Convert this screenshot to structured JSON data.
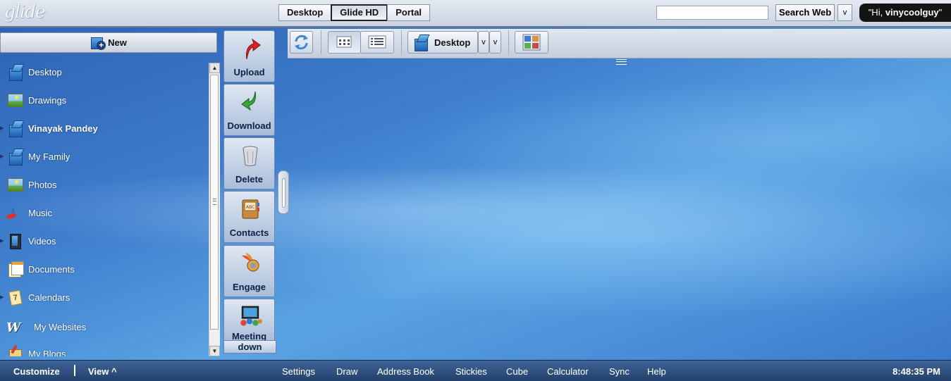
{
  "app": {
    "logo": "glide"
  },
  "top_tabs": [
    {
      "label": "Desktop",
      "active": false
    },
    {
      "label": "Glide HD",
      "active": true
    },
    {
      "label": "Portal",
      "active": false
    }
  ],
  "search": {
    "value": "",
    "button_label": "Search Web",
    "dropdown": "v"
  },
  "greeting": {
    "prefix": "\"Hi, ",
    "user": "vinycoolguy",
    "suffix": "\""
  },
  "new_button": {
    "label": "New"
  },
  "folders": [
    {
      "label": "Desktop",
      "icon": "desktop-folder-icon"
    },
    {
      "label": "Drawings",
      "icon": "image-folder-icon"
    },
    {
      "label": "Vinayak Pandey",
      "icon": "desktop-folder-icon",
      "selected": true
    },
    {
      "label": "My Family",
      "icon": "desktop-folder-icon"
    },
    {
      "label": "Photos",
      "icon": "image-folder-icon"
    },
    {
      "label": "Music",
      "icon": "music-icon"
    },
    {
      "label": "Videos",
      "icon": "film-icon"
    },
    {
      "label": "Documents",
      "icon": "documents-icon"
    },
    {
      "label": "Calendars",
      "icon": "calendar-icon"
    },
    {
      "label": "My Websites",
      "icon": "website-icon"
    },
    {
      "label": "My Blogs",
      "icon": "blog-icon"
    }
  ],
  "actions": [
    {
      "label": "Upload",
      "icon": "upload-arrow-icon"
    },
    {
      "label": "Download",
      "icon": "download-arrow-icon"
    },
    {
      "label": "Delete",
      "icon": "trash-icon"
    },
    {
      "label": "Contacts",
      "icon": "address-book-icon"
    },
    {
      "label": "Engage",
      "icon": "engage-icon"
    },
    {
      "label": "Meeting",
      "icon": "meeting-icon"
    }
  ],
  "meeting_down": "down",
  "toolbar": {
    "location": "Desktop",
    "dropdown": "v"
  },
  "taskbar": {
    "customize": "Customize",
    "view": "View ^",
    "links": [
      "Settings",
      "Draw",
      "Address Book",
      "Stickies",
      "Cube",
      "Calculator",
      "Sync",
      "Help"
    ],
    "clock": "8:48:35 PM"
  },
  "colors": {
    "taskbar": "#2d4e7d",
    "greeting_bg": "#141414",
    "desktop_blue": "#4a8fd8"
  }
}
